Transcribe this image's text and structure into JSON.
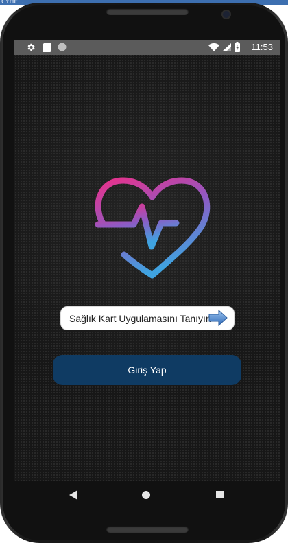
{
  "window": {
    "taskbar_text": "CYHE..."
  },
  "status_bar": {
    "icons": [
      "gear-icon",
      "sd-card-icon",
      "circle-icon"
    ],
    "right_icons": [
      "wifi-icon",
      "signal-icon",
      "battery-icon"
    ],
    "time": "11:53"
  },
  "logo": {
    "name": "heart-pulse-icon",
    "colors": [
      "#e8318a",
      "#8e5ac4",
      "#3fa3e0"
    ]
  },
  "info_button": {
    "label": "Sağlık Kart Uygulamasını Tanıyın",
    "icon": "arrow-right-icon"
  },
  "login_button": {
    "label": "Giriş Yap",
    "color": "#0f3b63"
  },
  "nav_bar": {
    "icons": [
      "back-icon",
      "home-icon",
      "recents-icon"
    ]
  }
}
